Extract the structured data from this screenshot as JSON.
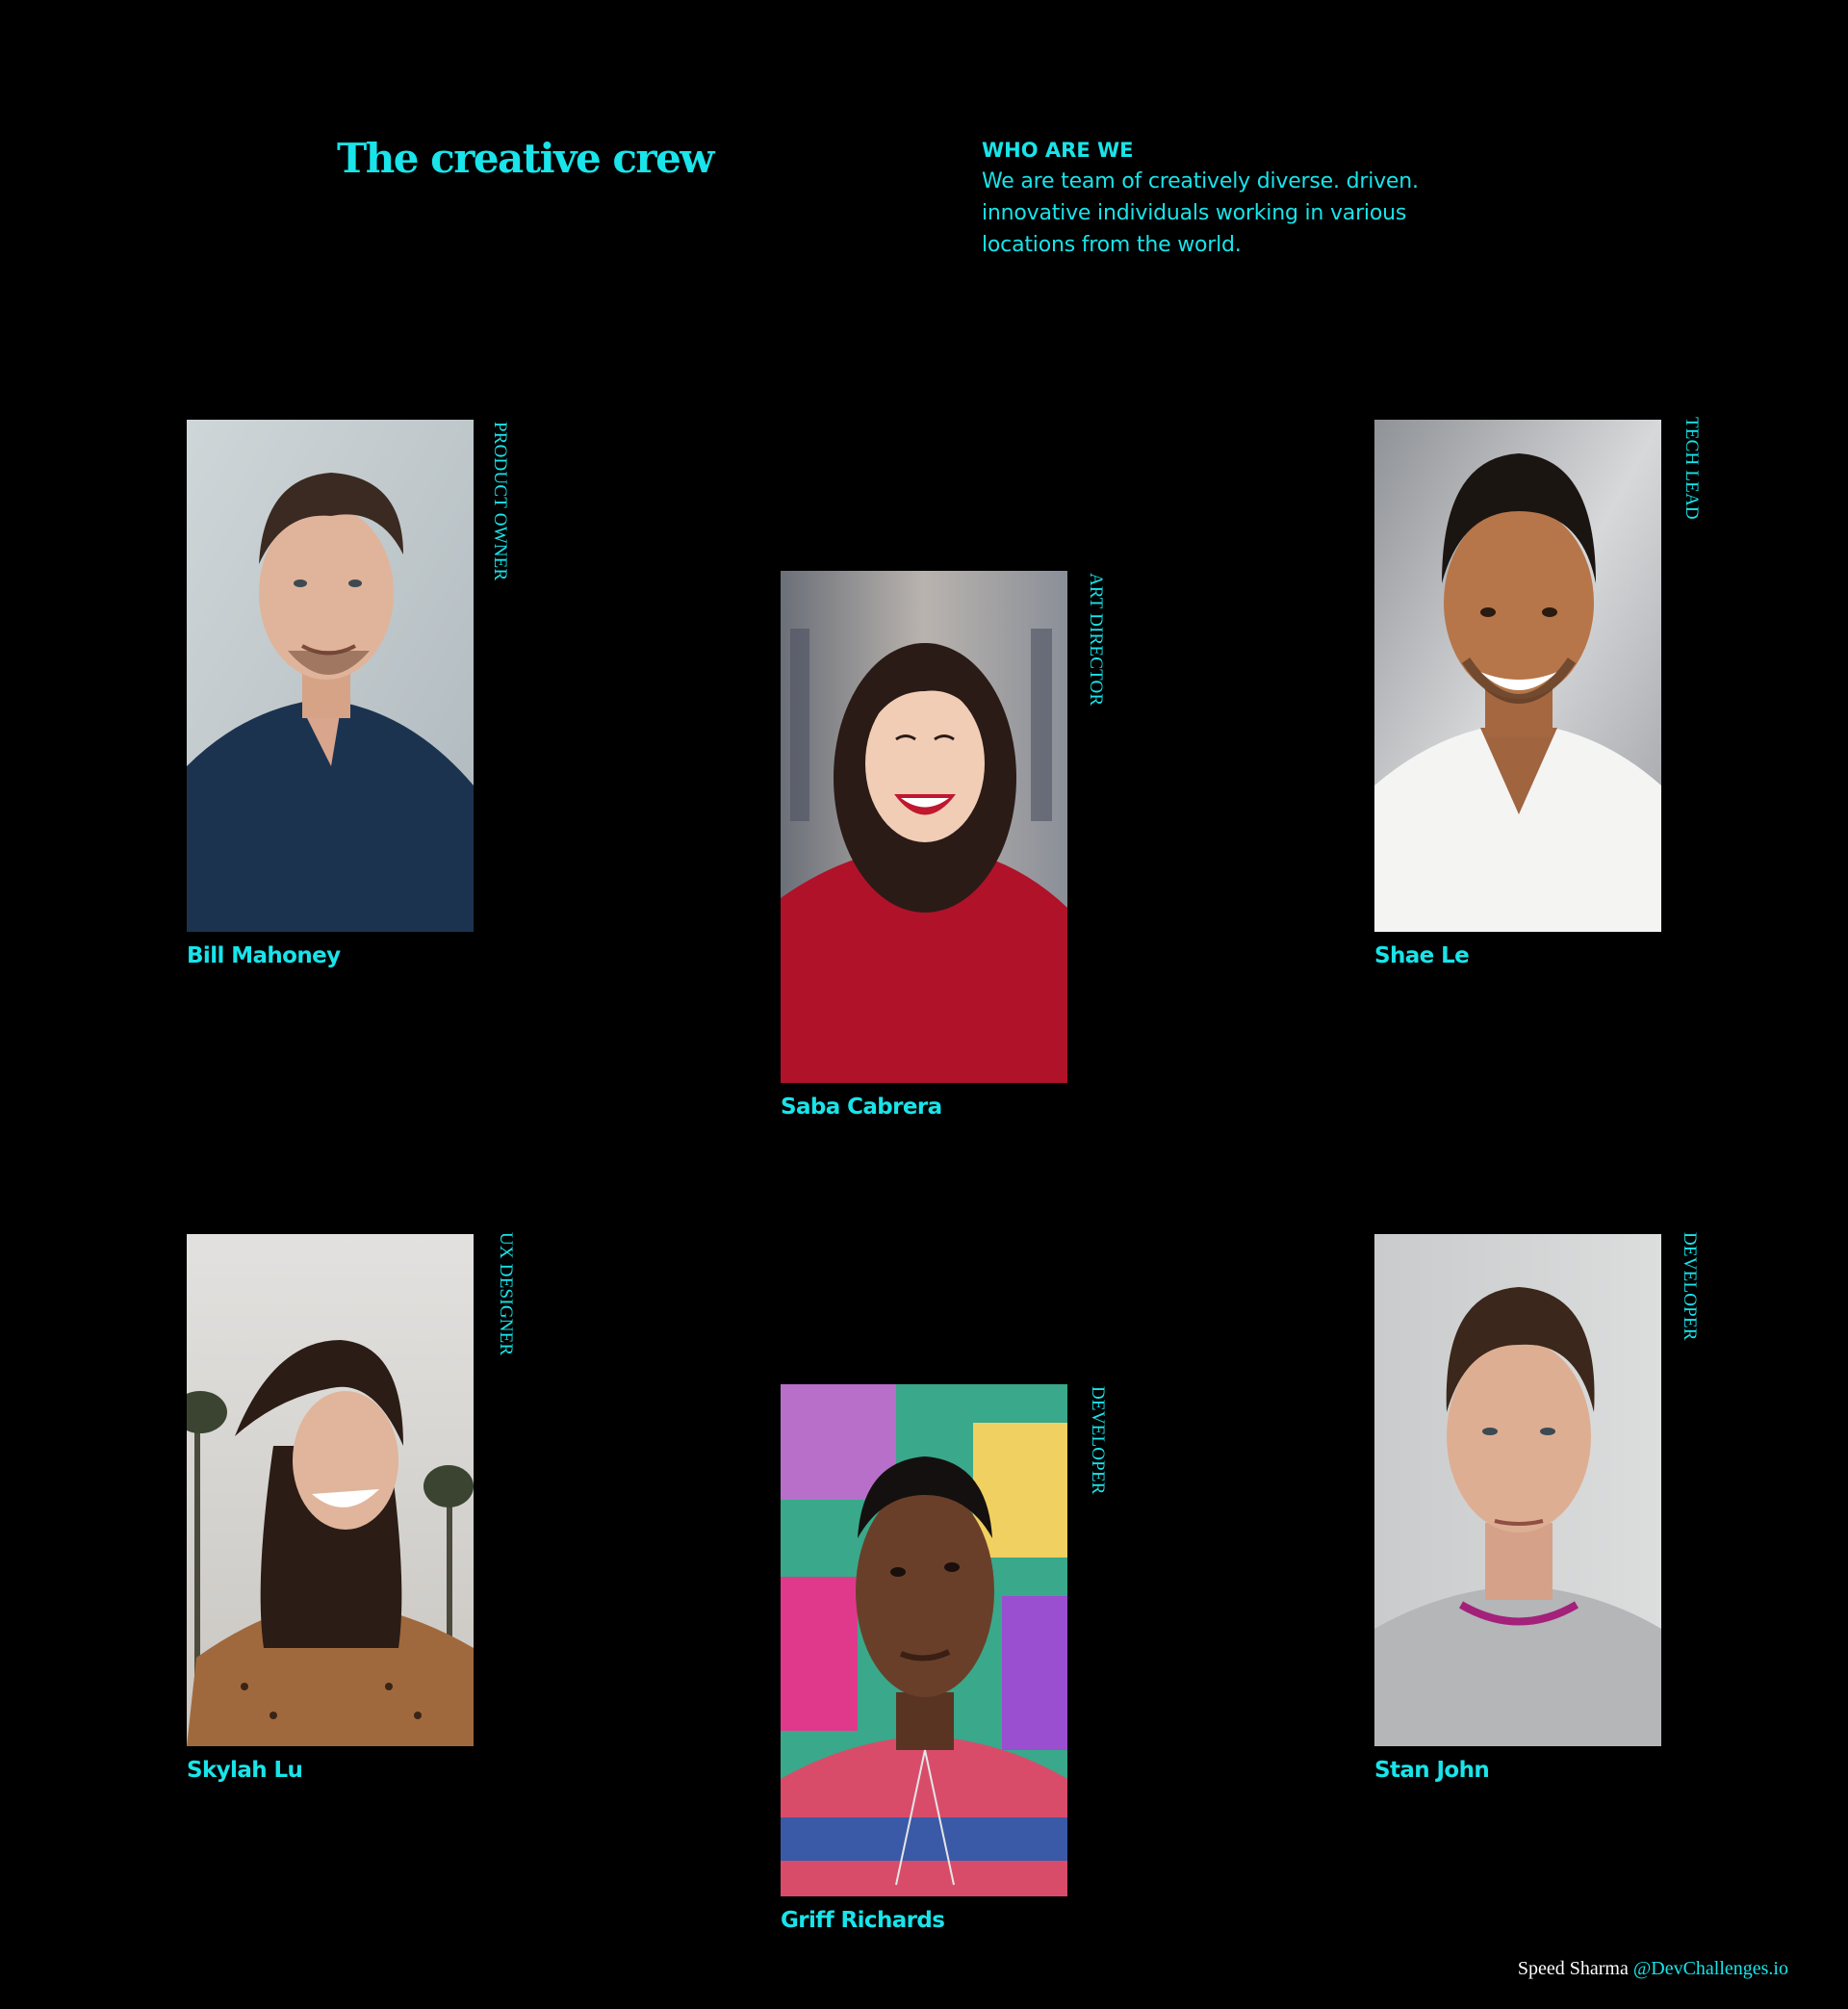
{
  "header": {
    "title": "The creative crew",
    "intro_heading": "WHO ARE WE",
    "intro_text": "We are team of creatively diverse. driven. innovative individuals working in various locations from the world."
  },
  "members": [
    {
      "name": "Bill Mahoney",
      "role": "PRODUCT OWNER"
    },
    {
      "name": "Saba Cabrera",
      "role": "ART DIRECTOR"
    },
    {
      "name": "Shae Le",
      "role": "TECH LEAD"
    },
    {
      "name": "Skylah Lu",
      "role": "UX DESIGNER"
    },
    {
      "name": "Griff Richards",
      "role": "DEVELOPER"
    },
    {
      "name": "Stan John",
      "role": "DEVELOPER"
    }
  ],
  "footer": {
    "author": "Speed Sharma",
    "link_text": "@DevChallenges.io"
  },
  "colors": {
    "background": "#000000",
    "accent": "#18e4ea",
    "footer_text": "#ffffff"
  }
}
